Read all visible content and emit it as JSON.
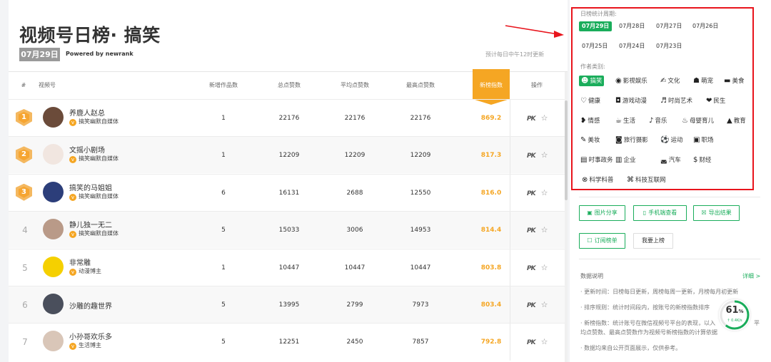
{
  "header": {
    "title": "视频号日榜· 搞笑",
    "date_badge": "07月29日",
    "powered_by": "Powered by newrank",
    "update_note": "预计每日中午12时更新"
  },
  "table": {
    "columns": [
      "#",
      "视频号",
      "新增作品数",
      "总点赞数",
      "平均点赞数",
      "最高点赞数",
      "新榜指数",
      "操作"
    ],
    "rows": [
      {
        "rank": "1",
        "name": "养鹿人赵总",
        "category": "搞笑幽默自媒体",
        "new_works": "1",
        "total_likes": "22176",
        "avg_likes": "22176",
        "max_likes": "22176",
        "index": "869.2"
      },
      {
        "rank": "2",
        "name": "文摇小剧场",
        "category": "搞笑幽默自媒体",
        "new_works": "1",
        "total_likes": "12209",
        "avg_likes": "12209",
        "max_likes": "12209",
        "index": "817.3"
      },
      {
        "rank": "3",
        "name": "搞笑的马姐姐",
        "category": "搞笑幽默自媒体",
        "new_works": "6",
        "total_likes": "16131",
        "avg_likes": "2688",
        "max_likes": "12550",
        "index": "816.0"
      },
      {
        "rank": "4",
        "name": "静儿独一无二",
        "category": "搞笑幽默自媒体",
        "new_works": "5",
        "total_likes": "15033",
        "avg_likes": "3006",
        "max_likes": "14953",
        "index": "814.4"
      },
      {
        "rank": "5",
        "name": "非常雕",
        "category": "动漫博主",
        "new_works": "1",
        "total_likes": "10447",
        "avg_likes": "10447",
        "max_likes": "10447",
        "index": "803.8"
      },
      {
        "rank": "6",
        "name": "沙雕的趣世界",
        "category": "",
        "new_works": "5",
        "total_likes": "13995",
        "avg_likes": "2799",
        "max_likes": "7973",
        "index": "803.4"
      },
      {
        "rank": "7",
        "name": "小孙哥欢乐多",
        "category": "生活博主",
        "new_works": "5",
        "total_likes": "12251",
        "avg_likes": "2450",
        "max_likes": "7857",
        "index": "792.8"
      }
    ],
    "op_pk": "PK",
    "op_star": "☆"
  },
  "sidebar": {
    "period_label": "日榜统计周期:",
    "periods": [
      "07月29日",
      "07月28日",
      "07月27日",
      "07月26日",
      "07月25日",
      "07月24日",
      "07月23日"
    ],
    "category_label": "作者类别:",
    "categories": [
      {
        "icon": "laugh-icon",
        "glyph": "☻",
        "label": "搞笑",
        "active": true
      },
      {
        "icon": "film-icon",
        "glyph": "◉",
        "label": "影视娱乐"
      },
      {
        "icon": "culture-icon",
        "glyph": "✍",
        "label": "文化"
      },
      {
        "icon": "pet-icon",
        "glyph": "☗",
        "label": "萌宠"
      },
      {
        "icon": "food-icon",
        "glyph": "▬",
        "label": "美食"
      },
      {
        "icon": "health-icon",
        "glyph": "♡",
        "label": "健康"
      },
      {
        "icon": "game-icon",
        "glyph": "◘",
        "label": "游戏动漫"
      },
      {
        "icon": "fashion-icon",
        "glyph": "♬",
        "label": "时尚艺术"
      },
      {
        "icon": "people-icon",
        "glyph": "❤",
        "label": "民生"
      },
      {
        "icon": "emotion-icon",
        "glyph": "❥",
        "label": "情感"
      },
      {
        "icon": "life-icon",
        "glyph": "☕",
        "label": "生活"
      },
      {
        "icon": "music-icon",
        "glyph": "♪",
        "label": "音乐"
      },
      {
        "icon": "baby-icon",
        "glyph": "♨",
        "label": "母婴育儿"
      },
      {
        "icon": "education-icon",
        "glyph": "▲",
        "label": "教育"
      },
      {
        "icon": "beauty-icon",
        "glyph": "✎",
        "label": "美妆"
      },
      {
        "icon": "camera-icon",
        "glyph": "◙",
        "label": "旅行摄影"
      },
      {
        "icon": "sport-icon",
        "glyph": "⚽",
        "label": "运动"
      },
      {
        "icon": "workplace-icon",
        "glyph": "▣",
        "label": "职场"
      },
      {
        "icon": "news-icon",
        "glyph": "▤",
        "label": "时事政务"
      },
      {
        "icon": "enterprise-icon",
        "glyph": "▥",
        "label": "企业"
      },
      {
        "icon": "car-icon",
        "glyph": "◛",
        "label": "汽车"
      },
      {
        "icon": "finance-icon",
        "glyph": "$",
        "label": "财经"
      },
      {
        "icon": "science-icon",
        "glyph": "⊗",
        "label": "科学科普"
      },
      {
        "icon": "tech-icon",
        "glyph": "⌘",
        "label": "科技互联网"
      }
    ],
    "buttons": {
      "share_image": "图片分享",
      "mobile_view": "手机端查看",
      "export": "导出结果",
      "subscribe": "订阅榜单",
      "join": "我要上榜"
    },
    "notes_title": "数据说明",
    "detail_link": "详细 >",
    "notes": [
      "· 更新时间：日榜每日更新，周榜每周一更新，月榜每月初更新",
      "· 排序规则：统计时间段内，按账号的新榜指数排序",
      "· 新榜指数：统计账号在微信视频号平台的表现，以入",
      "均点赞数、最高点赞数作为视频号新榜指数的计算依据",
      "· 数据均来自公开页面展示，仅供参考。"
    ],
    "note_suffix": "平",
    "gauge": {
      "percent": "61",
      "unit": "%",
      "speed": "↑ 0.4K/s",
      "value": 0.61
    }
  },
  "colors": {
    "accent": "#1aad5b",
    "hot": "#f5a623",
    "annotation": "#e8141c"
  }
}
